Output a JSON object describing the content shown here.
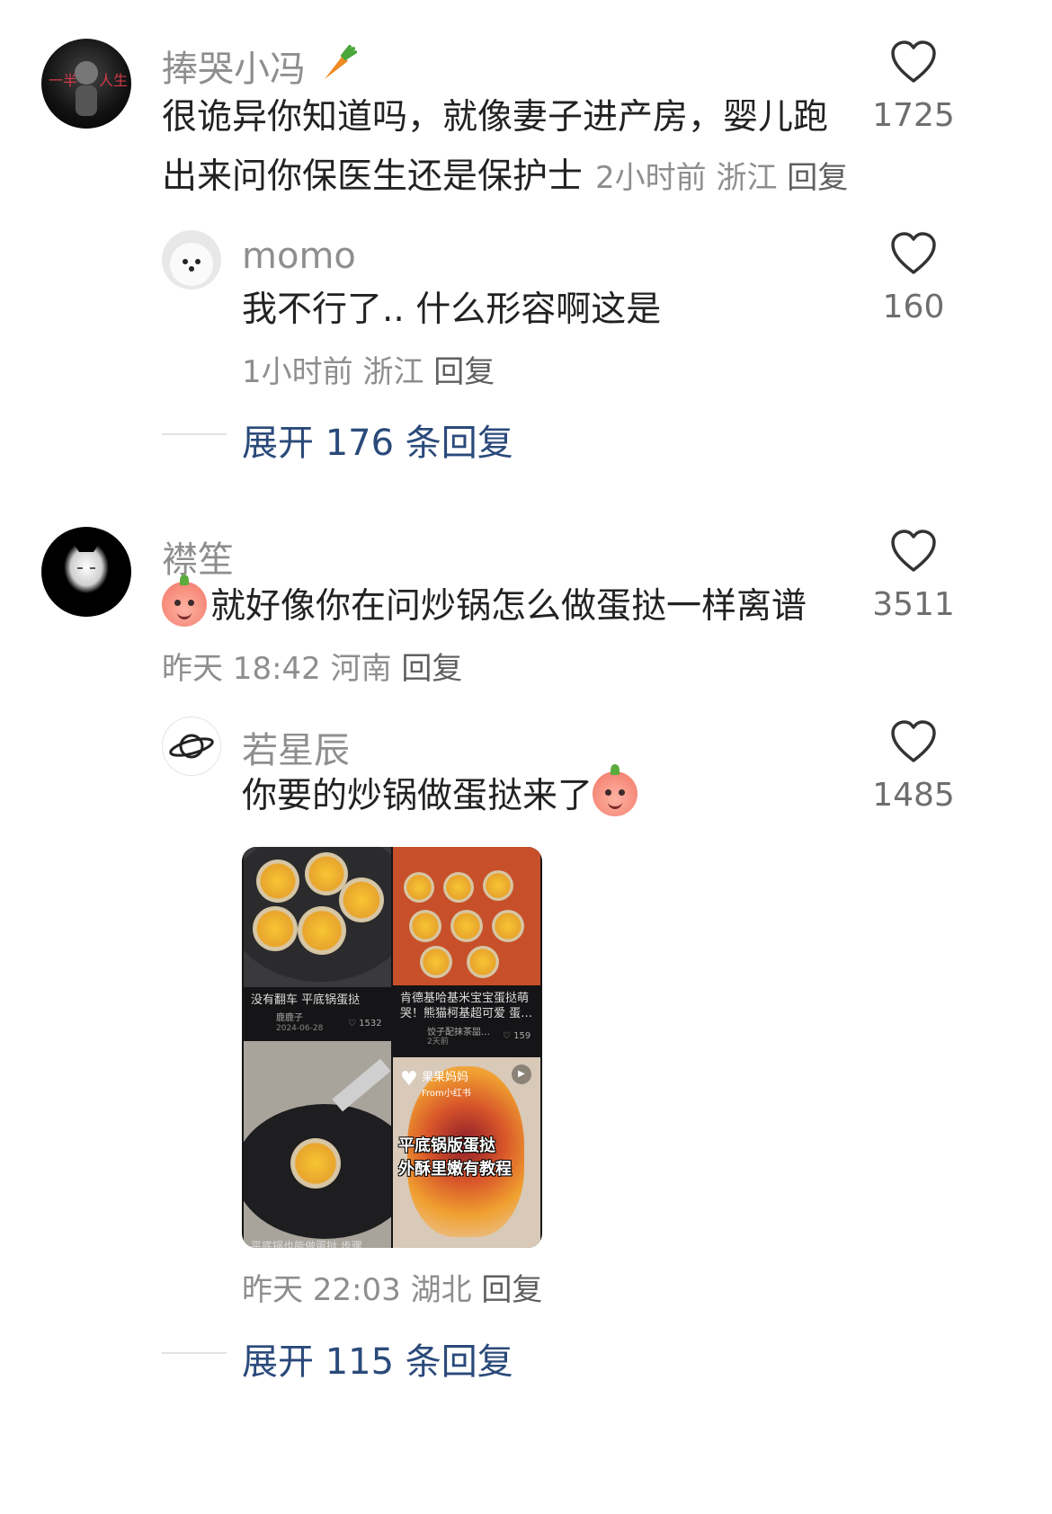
{
  "comments": [
    {
      "username": "捧哭小冯",
      "content": "很诡异你知道吗，就像妻子进产房，婴儿跑出来问你保医生还是保护士",
      "time": "2小时前",
      "location": "浙江",
      "reply_label": "回复",
      "likes": "1725",
      "icons": {
        "avatar": "user-avatar-dark",
        "badge": "carrot-icon",
        "like": "heart-outline-icon"
      }
    },
    {
      "username": "momo",
      "content": "我不行了.. 什么形容啊这是",
      "time": "1小时前",
      "location": "浙江",
      "reply_label": "回复",
      "likes": "160"
    },
    {
      "username": "襟笙",
      "content": "就好像你在问炒锅怎么做蛋挞一样离谱",
      "time": "昨天 18:42",
      "location": "河南",
      "reply_label": "回复",
      "likes": "3511"
    },
    {
      "username": "若星辰",
      "content": "你要的炒锅做蛋挞来了",
      "time": "昨天 22:03",
      "location": "湖北",
      "reply_label": "回复",
      "likes": "1485"
    }
  ],
  "expand_1": "展开 176 条回复",
  "expand_2": "展开 115 条回复",
  "attached_image": {
    "tile1_caption": "没有翻车 平底锅蛋挞",
    "tile1_author": "鹿鹿子",
    "tile1_date": "2024-06-28",
    "tile1_likes": "1532",
    "tile2_caption": "肯德基哈基米宝宝蛋挞萌哭！熊猫柯基超可爱 蛋…",
    "tile2_author": "饺子配抹茶㗊…",
    "tile2_date": "2天前",
    "tile2_likes": "159",
    "tile4_badge": "果果妈妈",
    "tile4_source": "From小红书",
    "tile4_title_line1": "平底锅版蛋挞",
    "tile4_title_line2": "外酥里嫩有教程",
    "tile3_caption": "平底锅也能做蛋挞 步骤"
  },
  "colors": {
    "link": "#2a4a7a",
    "meta": "#8e8e8e",
    "text": "#222222"
  }
}
